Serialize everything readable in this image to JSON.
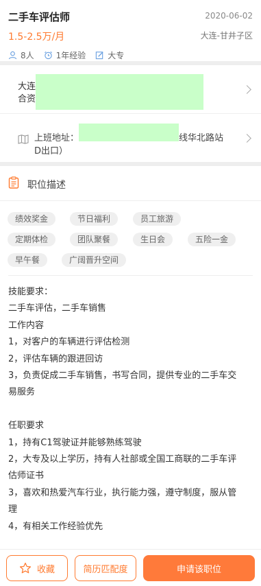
{
  "job": {
    "title": "二手车评估师",
    "date": "2020-06-02",
    "salary": "1.5-2.5万/月",
    "district": "大连-甘井子区",
    "headcount": "8人",
    "experience": "1年经验",
    "education": "大专"
  },
  "company": {
    "name_line": "大连",
    "type_line": "合资"
  },
  "address": {
    "label": "上班地址：",
    "suffix": "线华北路站",
    "line2": "D出口）"
  },
  "section": {
    "title": "职位描述"
  },
  "benefits": [
    "绩效奖金",
    "节日福利",
    "员工旅游",
    "定期体检",
    "团队聚餐",
    "生日会",
    "五险一金",
    "早午餐",
    "广阔晋升空间"
  ],
  "description": [
    "技能要求：",
    "二手车评估，二手车销售",
    "工作内容",
    "1，对客户的车辆进行评估检测",
    "2，评估车辆的跟进回访",
    "3，负责促成二手车销售，书写合同，提供专业的二手车交",
    "易服务",
    "",
    "任职要求",
    "1，持有C1驾驶证并能够熟练驾驶",
    "2，大专及以上学历，持有人社部或全国工商联的二手车评",
    "估师证书",
    "3，喜欢和热爱汽车行业，执行能力强，遵守制度，服从管",
    "理",
    "4，有相关工作经验优先"
  ],
  "actions": {
    "favorite": "收藏",
    "match": "简历匹配度",
    "apply": "申请该职位"
  },
  "colors": {
    "accent": "#ff7a2f",
    "redacted": "#c9ffc9"
  }
}
